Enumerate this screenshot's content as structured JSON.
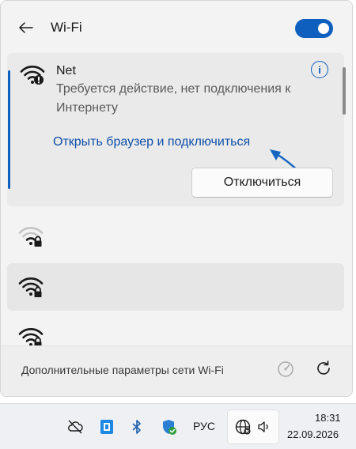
{
  "header": {
    "title": "Wi-Fi",
    "wifi_enabled": true
  },
  "network": {
    "name": "Net",
    "status": "Требуется действие, нет подключения к Интернету",
    "browser_link": "Открыть браузер и подключиться",
    "disconnect_label": "Отключиться"
  },
  "other_networks": [
    {
      "icon": "wifi-lock-icon",
      "signal": "medium",
      "secured": true
    },
    {
      "icon": "wifi-lock-icon",
      "signal": "full",
      "secured": true
    },
    {
      "icon": "wifi-lock-icon",
      "signal": "full",
      "secured": true
    }
  ],
  "footer": {
    "more_settings": "Дополнительные параметры сети Wi-Fi"
  },
  "taskbar": {
    "language": "РУС",
    "time": "18:31",
    "date": "22.09.2026"
  },
  "colors": {
    "accent": "#0f5fbf",
    "link": "#0f4fa8",
    "annotation_arrow": "#1565c0"
  }
}
